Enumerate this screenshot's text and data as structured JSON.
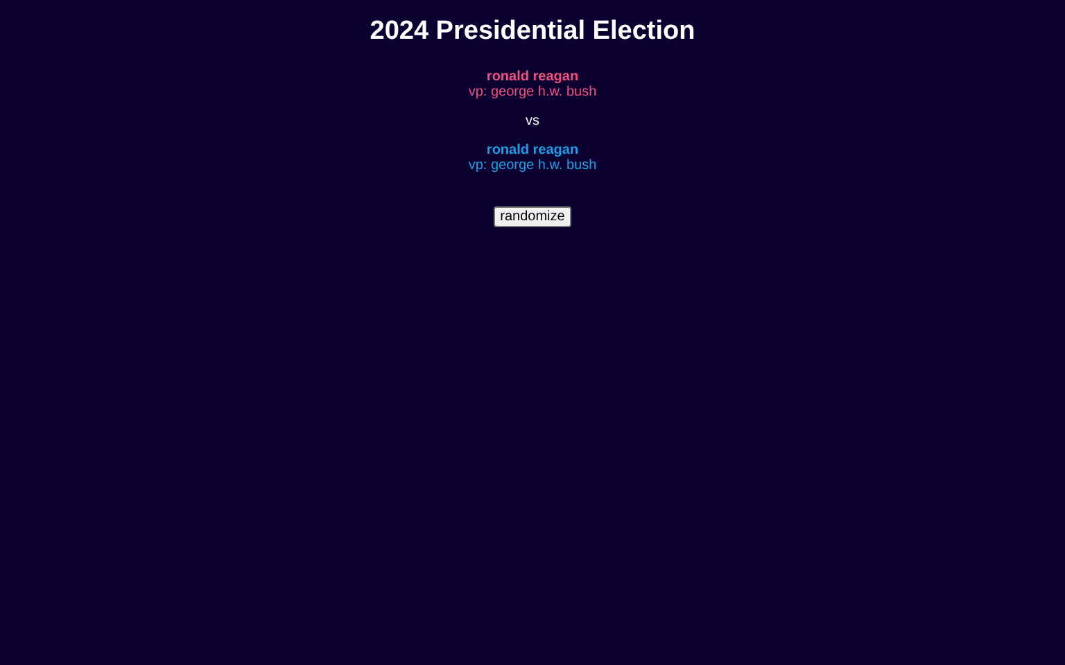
{
  "title": "2024 Presidential Election",
  "tickets": [
    {
      "president": "ronald reagan",
      "vp": "vp: george h.w. bush",
      "color": "#f0507f"
    },
    {
      "president": "ronald reagan",
      "vp": "vp: george h.w. bush",
      "color": "#1c9fe6"
    }
  ],
  "separator": "vs",
  "button": "randomize"
}
